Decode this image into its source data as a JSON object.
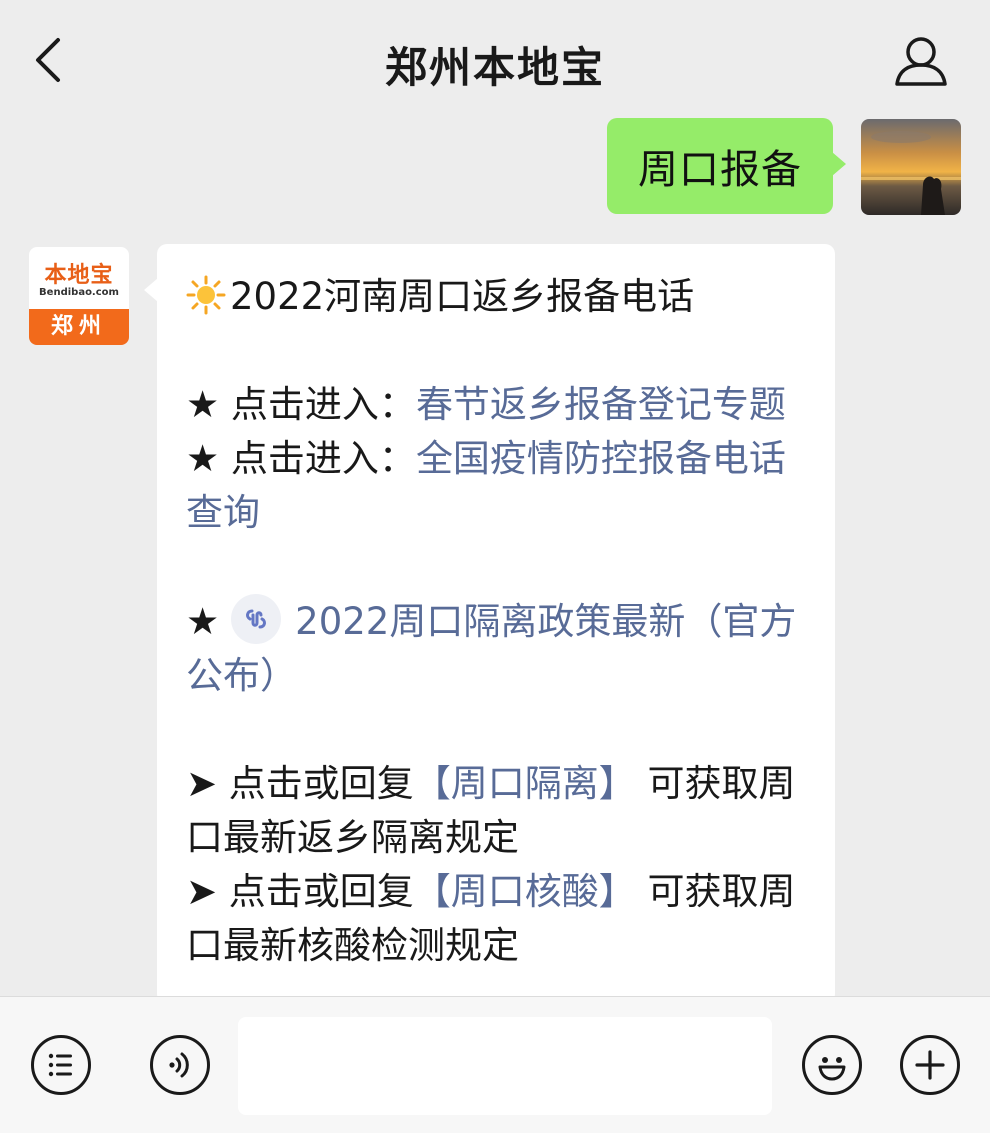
{
  "header": {
    "title": "郑州本地宝"
  },
  "user_message": {
    "text": "周口报备"
  },
  "bot_avatar": {
    "brand": "本地宝",
    "url": "Bendibao.com",
    "city": "郑州"
  },
  "bot_message": {
    "headline": "2022河南周口返乡报备电话",
    "items": [
      {
        "prefix": "★ 点击进入：",
        "link": "春节返乡报备登记专题"
      },
      {
        "prefix": "★ 点击进入：",
        "link": "全国疫情防控报备电话查询"
      },
      {
        "prefix": "★",
        "link": "2022周口隔离政策最新（官方公布）"
      }
    ],
    "replies": [
      {
        "prefix": "➤ 点击或回复",
        "keyword": "【周口隔离】",
        "suffix": " 可获取周口最新返乡隔离规定"
      },
      {
        "prefix": "➤ 点击或回复",
        "keyword": "【周口核酸】",
        "suffix": " 可获取周口最新核酸检测规定"
      }
    ]
  },
  "colors": {
    "background": "#ededed",
    "user_bubble": "#95ec69",
    "bot_bubble": "#ffffff",
    "link": "#586b97",
    "brand_orange": "#f26a1b"
  },
  "icons": [
    "back-arrow-icon",
    "person-icon",
    "sun-icon",
    "mini-program-icon",
    "menu-list-icon",
    "voice-icon",
    "emoji-icon",
    "plus-icon"
  ]
}
